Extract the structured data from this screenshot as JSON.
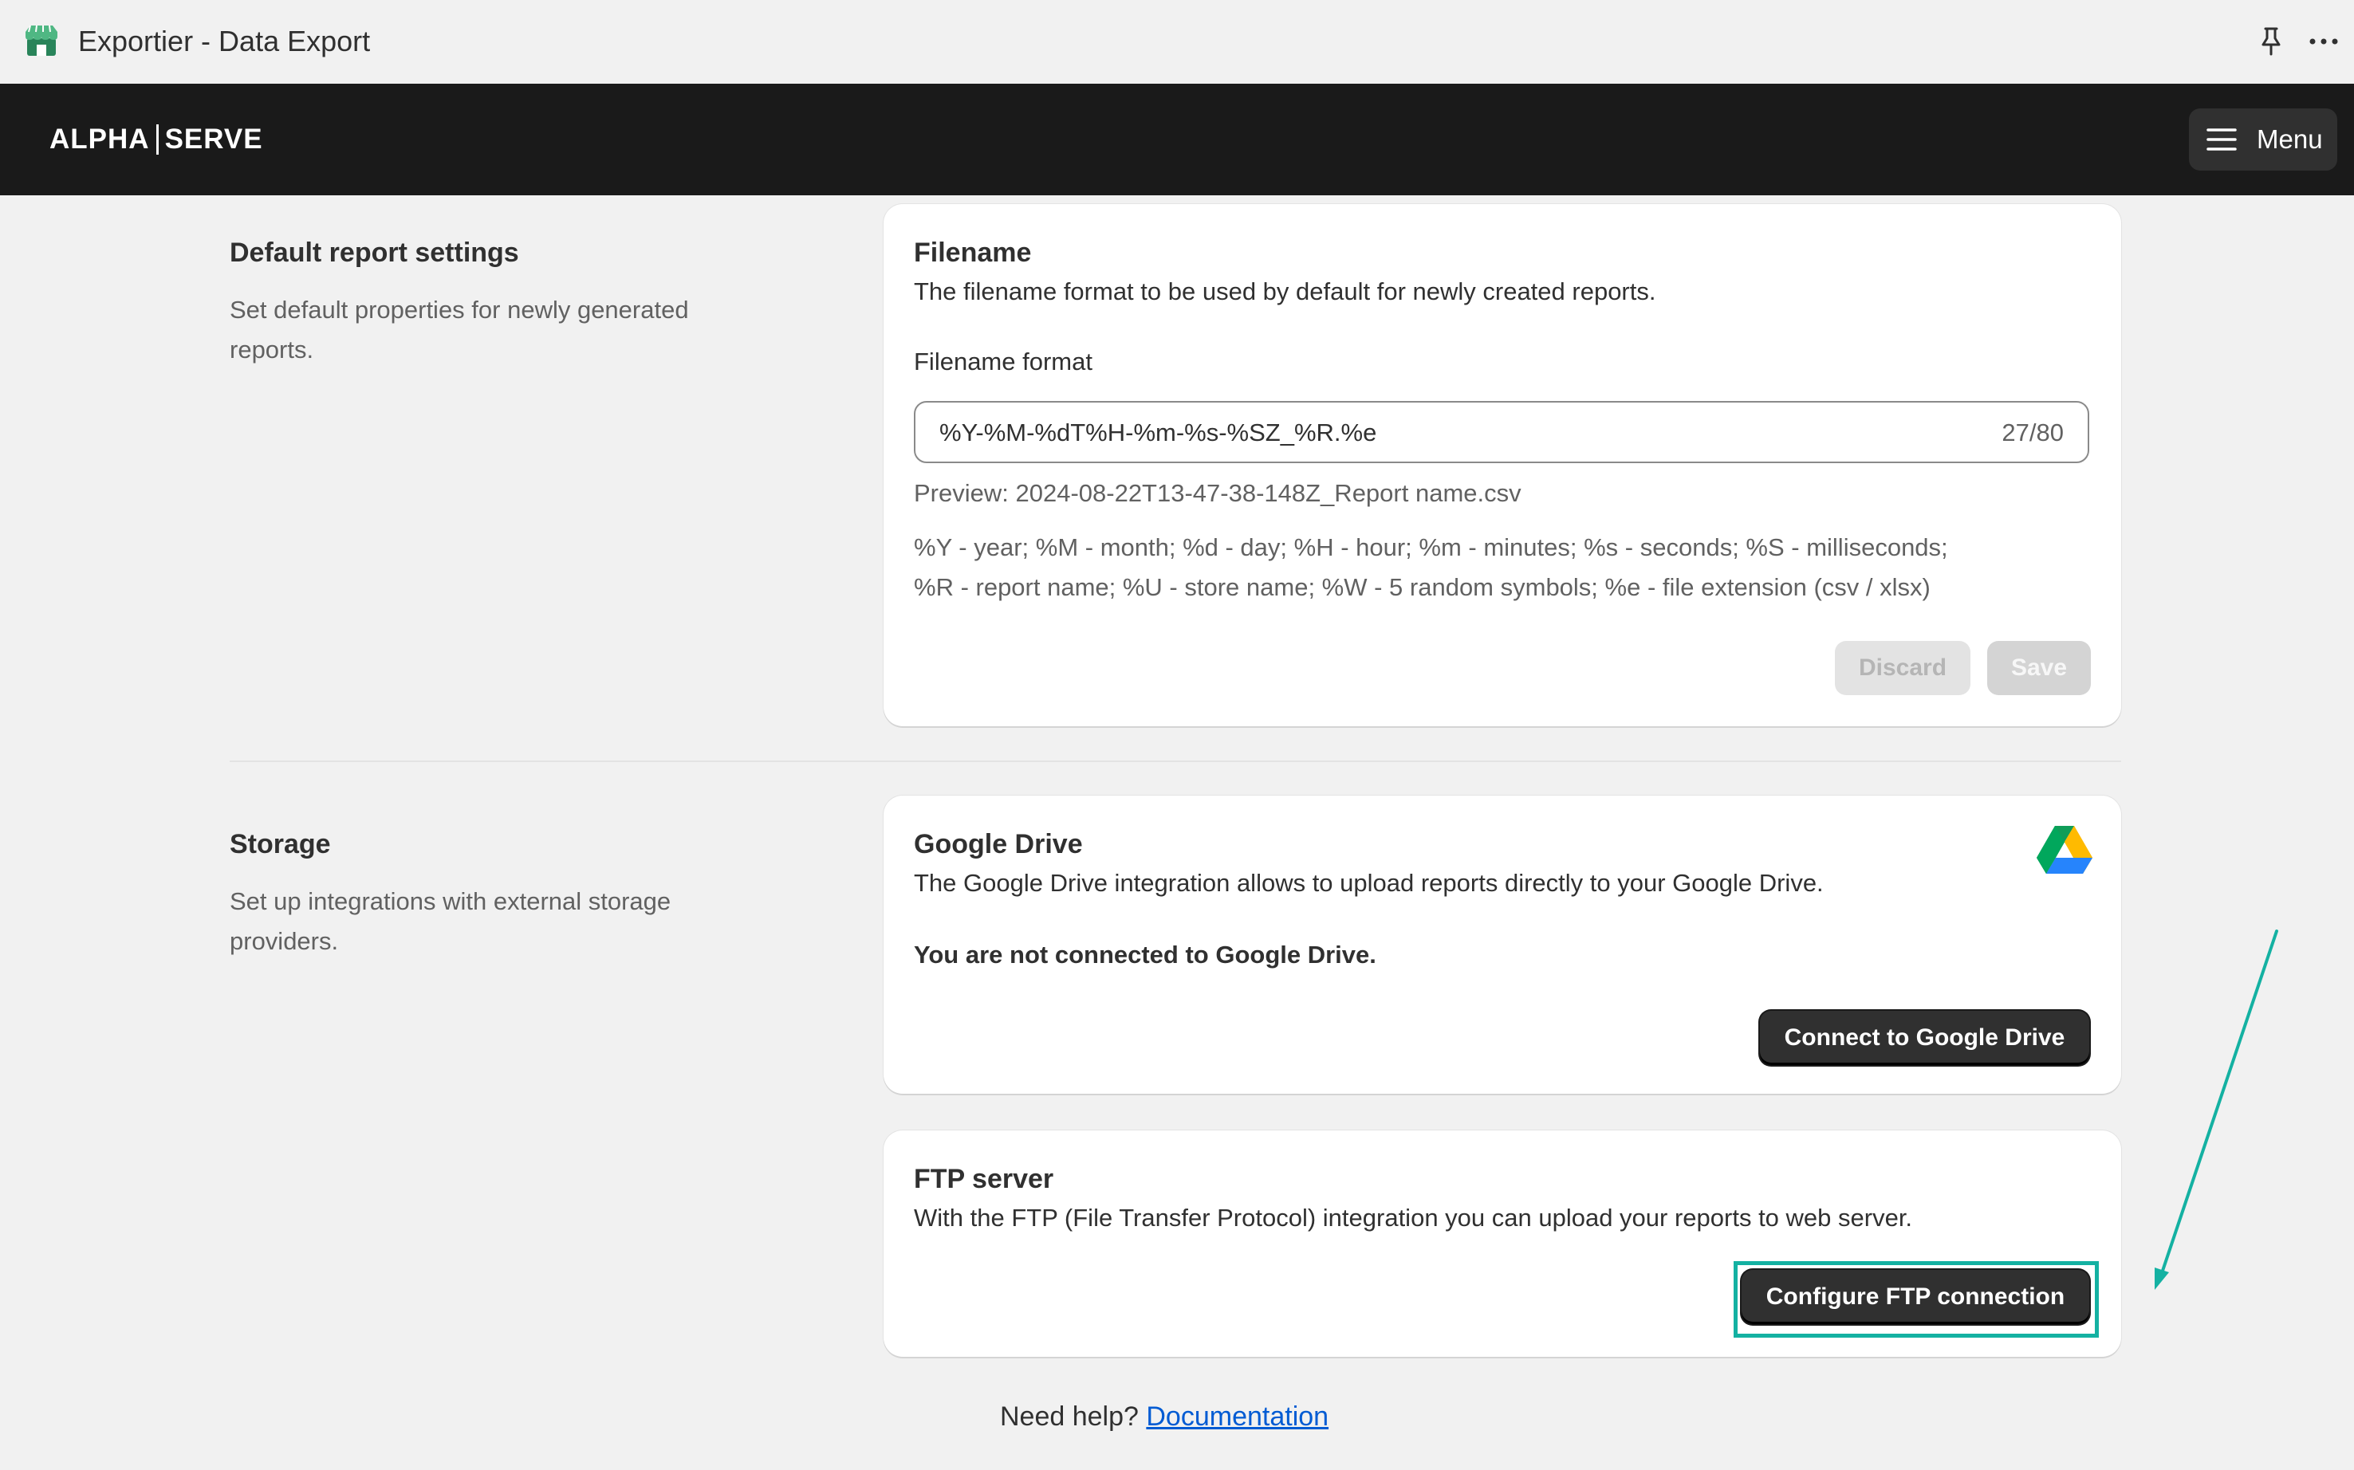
{
  "app": {
    "title": "Exportier - Data Export"
  },
  "header": {
    "logo_left": "ALPHA",
    "logo_right": "SERVE",
    "menu_label": "Menu"
  },
  "default_report": {
    "title": "Default report settings",
    "description": "Set default properties for newly generated reports.",
    "card": {
      "title": "Filename",
      "subtitle": "The filename format to be used by default for newly created reports.",
      "field_label": "Filename format",
      "field_value": "%Y-%M-%dT%H-%m-%s-%SZ_%R.%e",
      "counter": "27/80",
      "preview": "Preview: 2024-08-22T13-47-38-148Z_Report name.csv",
      "help_line1": "%Y - year; %M - month; %d - day; %H - hour; %m - minutes; %s - seconds; %S - milliseconds;",
      "help_line2": "%R - report name; %U - store name; %W - 5 random symbols; %e - file extension (csv / xlsx)",
      "discard_label": "Discard",
      "save_label": "Save"
    }
  },
  "storage": {
    "title": "Storage",
    "description": "Set up integrations with external storage providers.",
    "google_drive": {
      "title": "Google Drive",
      "subtitle": "The Google Drive integration allows to upload reports directly to your Google Drive.",
      "status": "You are not connected to Google Drive.",
      "button_label": "Connect to Google Drive"
    },
    "ftp": {
      "title": "FTP server",
      "subtitle": "With the FTP (File Transfer Protocol) integration you can upload your reports to web server.",
      "button_label": "Configure FTP connection"
    }
  },
  "footer": {
    "prefix": "Need help?",
    "link": "Documentation"
  },
  "colors": {
    "highlight": "#14b1a2",
    "link": "#005bd3",
    "header_bg": "#1a1a1a"
  }
}
